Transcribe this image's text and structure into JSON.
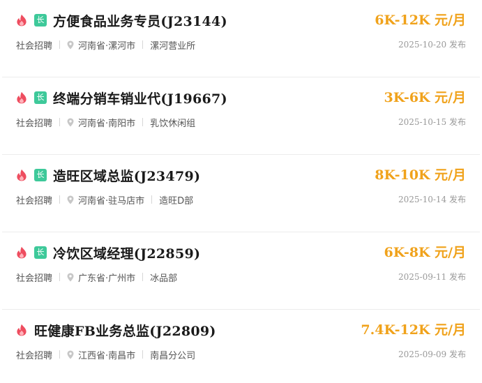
{
  "jobs": [
    {
      "title": "方便食品业务专员(J23144)",
      "salary": "6K-12K 元/月",
      "type": "社会招聘",
      "location": "河南省·漯河市",
      "department": "漯河营业所",
      "date": "2025-10-20 发布",
      "badge": "长",
      "hot": true
    },
    {
      "title": "终端分销车销业代(J19667)",
      "salary": "3K-6K 元/月",
      "type": "社会招聘",
      "location": "河南省·南阳市",
      "department": "乳饮休闲组",
      "date": "2025-10-15 发布",
      "badge": "长",
      "hot": true
    },
    {
      "title": "造旺区域总监(J23479)",
      "salary": "8K-10K 元/月",
      "type": "社会招聘",
      "location": "河南省·驻马店市",
      "department": "造旺D部",
      "date": "2025-10-14 发布",
      "badge": "长",
      "hot": true
    },
    {
      "title": "冷饮区域经理(J22859)",
      "salary": "6K-8K 元/月",
      "type": "社会招聘",
      "location": "广东省·广州市",
      "department": "冰品部",
      "date": "2025-09-11 发布",
      "badge": "长",
      "hot": true
    },
    {
      "title": "旺健康FB业务总监(J22809)",
      "salary": "7.4K-12K 元/月",
      "type": "社会招聘",
      "location": "江西省·南昌市",
      "department": "南昌分公司",
      "date": "2025-09-09 发布",
      "badge": "",
      "hot": true
    }
  ],
  "icons": {
    "hot": "fire-icon",
    "location": "location-pin-icon"
  },
  "colors": {
    "salary": "#f0a21b",
    "fire": "#ee4d5f",
    "badge": "#3ec99a",
    "meta_text": "#555555",
    "date_text": "#999999",
    "divider": "#ececec"
  }
}
